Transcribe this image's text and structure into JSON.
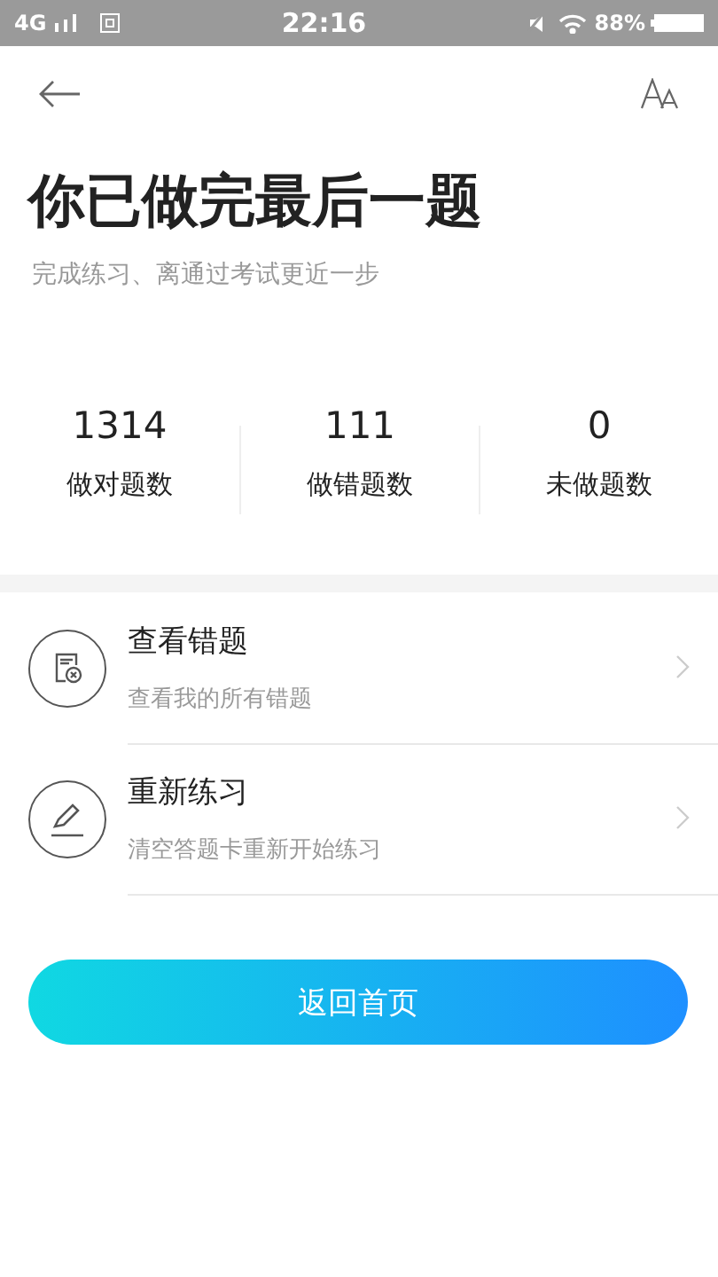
{
  "status_bar": {
    "network": "4G",
    "time": "22:16",
    "battery": "88%"
  },
  "title": "你已做完最后一题",
  "subtitle": "完成练习、离通过考试更近一步",
  "stats": [
    {
      "value": "1314",
      "label": "做对题数"
    },
    {
      "value": "111",
      "label": "做错题数"
    },
    {
      "value": "0",
      "label": "未做题数"
    }
  ],
  "actions": [
    {
      "kind": "wrong",
      "title": "查看错题",
      "description": "查看我的所有错题"
    },
    {
      "kind": "redo",
      "title": "重新练习",
      "description": "清空答题卡重新开始练习"
    }
  ],
  "home_button": "返回首页"
}
